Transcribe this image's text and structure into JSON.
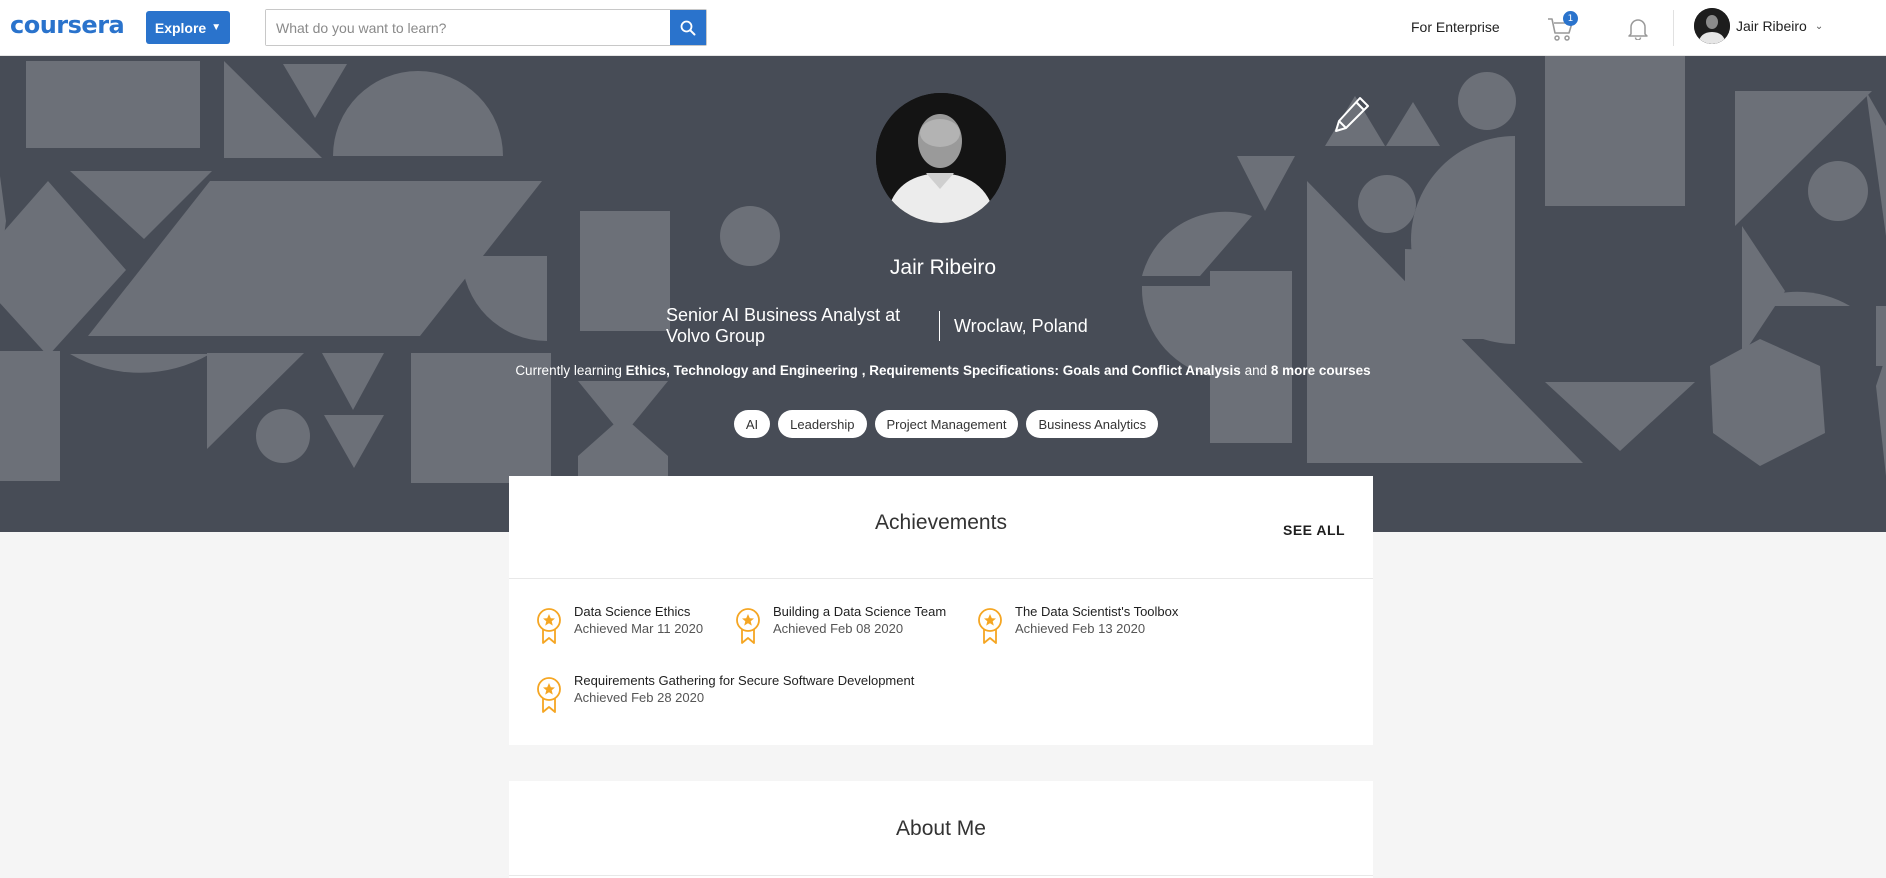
{
  "colors": {
    "brand": "#2a73cc",
    "banner": "#474c56",
    "shape": "#6c7078",
    "star": "#f5a623"
  },
  "header": {
    "logo": "coursera",
    "explore_label": "Explore",
    "search_placeholder": "What do you want to learn?",
    "enterprise_label": "For Enterprise",
    "cart_count": "1",
    "user_name": "Jair Ribeiro"
  },
  "profile": {
    "name": "Jair Ribeiro",
    "title": "Senior AI Business Analyst at Volvo Group",
    "location": "Wroclaw, Poland",
    "learning_prefix": "Currently learning",
    "course_1": "Ethics, Technology and Engineering",
    "course_sep": ",",
    "course_2": "Requirements Specifications: Goals and Conflict Analysis",
    "learning_and": "and",
    "more_courses": "8 more courses",
    "tags": [
      "AI",
      "Leadership",
      "Project Management",
      "Business Analytics"
    ]
  },
  "achievements": {
    "title": "Achievements",
    "see_all": "SEE ALL",
    "items": [
      {
        "name": "Data Science Ethics",
        "date": "Achieved Mar 11 2020"
      },
      {
        "name": "Building a Data Science Team",
        "date": "Achieved Feb 08 2020"
      },
      {
        "name": "The Data Scientist's Toolbox",
        "date": "Achieved Feb 13 2020"
      },
      {
        "name": "Requirements Gathering for Secure Software Development",
        "date": "Achieved Feb 28 2020"
      }
    ]
  },
  "about": {
    "title": "About Me"
  },
  "icons": [
    "search-icon",
    "cart-icon",
    "bell-icon",
    "pencil-icon",
    "award-ribbon-icon",
    "chevron-down-icon"
  ]
}
